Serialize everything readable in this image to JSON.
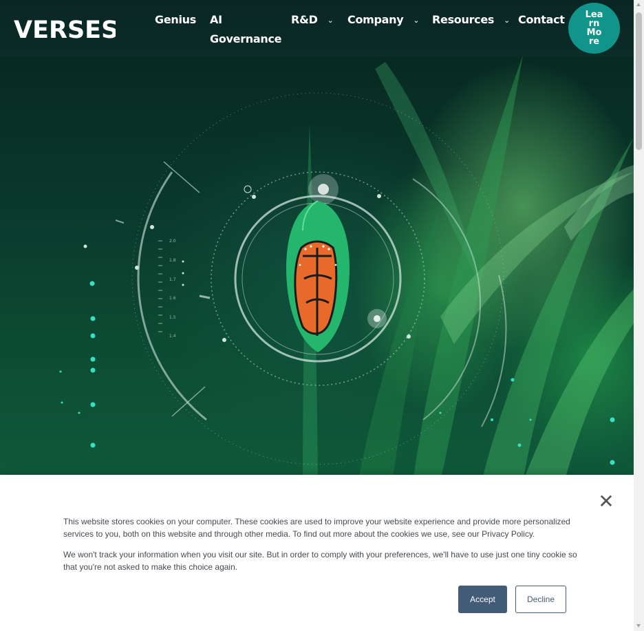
{
  "header": {
    "logo_text": "VERSES",
    "nav": [
      {
        "label": "Genius",
        "has_dropdown": false
      },
      {
        "label": "AI Governance",
        "has_dropdown": false
      },
      {
        "label": "R&D",
        "has_dropdown": true
      },
      {
        "label": "Company",
        "has_dropdown": true
      },
      {
        "label": "Resources",
        "has_dropdown": true
      },
      {
        "label": "Contact",
        "has_dropdown": false
      }
    ],
    "cta_label": "Learn More",
    "icons": {
      "dropdown": "chevron-down-icon"
    }
  },
  "hero": {
    "hud_ticks": [
      "2.0",
      "1.8",
      "1.7",
      "1.6",
      "1.5",
      "1.4"
    ],
    "image_subject": "chrysalis with butterfly wing pattern inside circular HUD rings over green grass"
  },
  "cookie_banner": {
    "text_1": "This website stores cookies on your computer. These cookies are used to improve your website experience and provide more personalized services to you, both on this website and through other media. To find out more about the cookies we use, see our Privacy Policy.",
    "text_2": "We won't track your information when you visit our site. But in order to comply with your preferences, we'll have to use just one tiny cookie so that you're not asked to make this choice again.",
    "accept_label": "Accept",
    "decline_label": "Decline",
    "close_icon": "close-icon"
  },
  "colors": {
    "header_bg": "#0c2a28",
    "cta_bg": "#11958b",
    "button_primary": "#425b76",
    "cookie_text": "#444a52"
  }
}
